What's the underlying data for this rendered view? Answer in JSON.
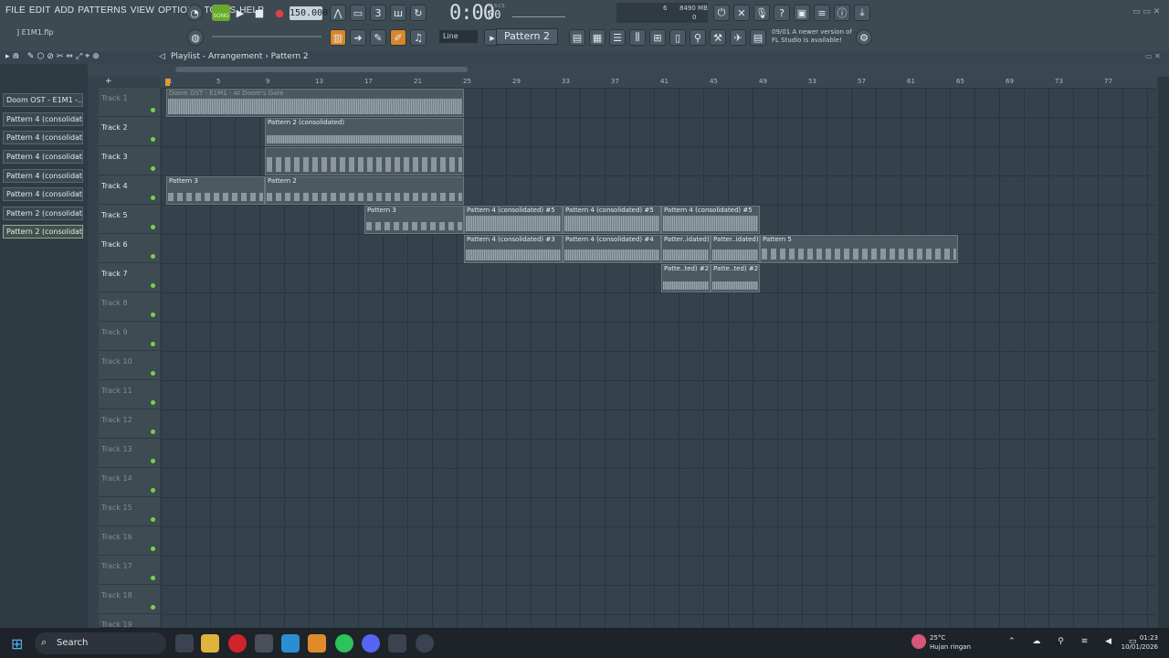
{
  "menu": [
    "FILE",
    "EDIT",
    "ADD",
    "PATTERNS",
    "VIEW",
    "OPTIONS",
    "TOOLS",
    "HELP"
  ],
  "transport": {
    "mode": "SONG",
    "tempo": "150.000",
    "time": "0:00",
    "time_frac": "00",
    "time_unit": "M:S:CS"
  },
  "monitor": {
    "cpu": "6",
    "memory": "8490 MB",
    "cpu_small": "0"
  },
  "project": {
    "filename": "] E1M1.flp"
  },
  "toolbar": {
    "snap": "Line",
    "pattern": "Pattern 2"
  },
  "news": {
    "line1": "09/01 A newer version of",
    "line2": "FL Studio is available!"
  },
  "playlist": {
    "title": "Playlist - Arrangement › Pattern 2"
  },
  "picker": [
    {
      "label": "Doom OST - E1M1 -..."
    },
    {
      "label": "Pattern 4 (consolidat..."
    },
    {
      "label": "Pattern 4 (consolidat..."
    },
    {
      "label": "Pattern 4 (consolidat..."
    },
    {
      "label": "Pattern 4 (consolidat..."
    },
    {
      "label": "Pattern 4 (consolidat..."
    },
    {
      "label": "Pattern 2 (consolidat..."
    },
    {
      "label": "Pattern 2 (consolidat..."
    }
  ],
  "ruler": [
    "1",
    "5",
    "9",
    "13",
    "17",
    "21",
    "25",
    "29",
    "33",
    "37",
    "41",
    "45",
    "49",
    "53",
    "57",
    "61",
    "65",
    "69",
    "73",
    "77"
  ],
  "tracks": [
    "Track 1",
    "Track 2",
    "Track 3",
    "Track 4",
    "Track 5",
    "Track 6",
    "Track 7",
    "Track 8",
    "Track 9",
    "Track 10",
    "Track 11",
    "Track 12",
    "Track 13",
    "Track 14",
    "Track 15",
    "Track 16",
    "Track 17",
    "Track 18",
    "Track 19"
  ],
  "clips": {
    "c1": "Doom OST - E1M1 - At Doom's Gate",
    "c2": "Pattern 2 (consolidated)",
    "c4a": "Pattern 3",
    "c4b": "Pattern 2",
    "c5a": "Pattern 3",
    "c5b": "Pattern 4 (consolidated) #5",
    "c5c": "Pattern 4 (consolidated) #5",
    "c5d": "Pattern 4 (consolidated) #5",
    "c6a": "Pattern 4 (consolidated) #3",
    "c6b": "Pattern 4 (consolidated) #4",
    "c6c": "Patter..idated)",
    "c6d": "Patter..idated)",
    "c6e": "Pattern 5",
    "c7a": "Patte..ted) #2",
    "c7b": "Patte..ted) #2"
  },
  "taskbar": {
    "search": "Search",
    "temp": "25°C",
    "weather": "Hujan ringan",
    "time": "01:23",
    "date": "10/01/2026"
  }
}
